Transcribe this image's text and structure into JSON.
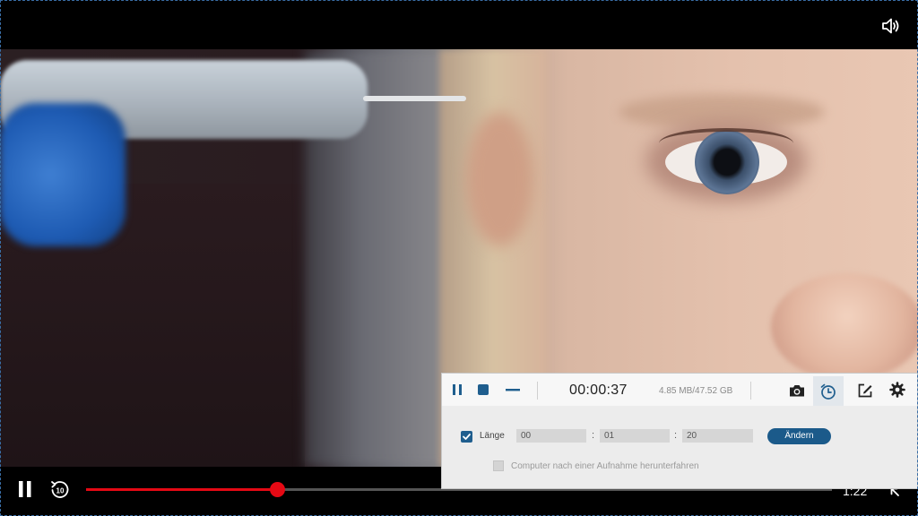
{
  "player": {
    "time_remaining": "1:22",
    "progress_fraction": 0.256,
    "accent_color": "#e50914",
    "icons": {
      "volume": "volume-icon",
      "pause": "pause-icon",
      "rewind": "rewind-10-icon",
      "rewind_label": "10",
      "fullscreen": "exit-fullscreen-icon"
    }
  },
  "recorder": {
    "elapsed": "00:00:37",
    "file_size": "4.85 MB/47.52 GB",
    "toolbar_icons": [
      "pause-icon",
      "stop-icon",
      "minimize-icon",
      "camera-icon",
      "alarm-clock-icon",
      "edit-icon",
      "gear-icon"
    ],
    "length_label": "Länge",
    "length_checked": true,
    "hours": "00",
    "minutes": "01",
    "seconds": "20",
    "separator": ":",
    "change_button": "Ändern",
    "shutdown_label": "Computer nach einer Aufnahme herunterfahren",
    "shutdown_checked": false,
    "accent_color": "#1b5a8a"
  }
}
